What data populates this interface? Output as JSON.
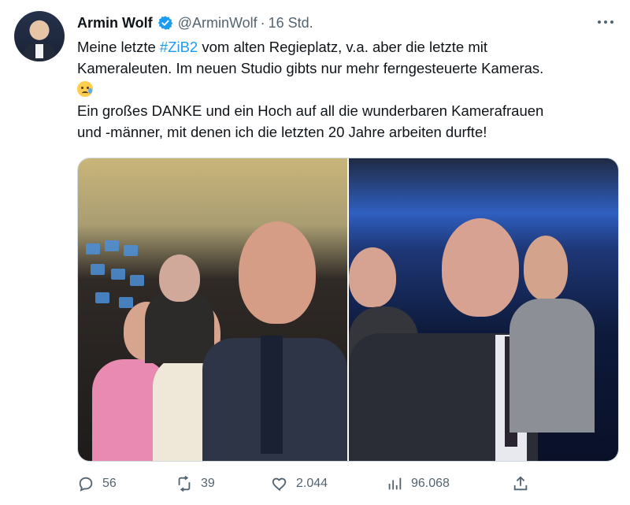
{
  "tweet": {
    "author": {
      "name": "Armin Wolf",
      "handle": "@ArminWolf",
      "time": "16 Std.",
      "separator": "·"
    },
    "text": {
      "line1_before": "Meine letzte ",
      "hashtag": "#ZiB2",
      "line1_after": " vom alten Regieplatz, v.a. aber die letzte mit",
      "line2": "Kameraleuten. Im neuen Studio gibts nur mehr ferngesteuerte Kameras.",
      "line3": "Ein großes DANKE und ein Hoch auf all die wunderbaren Kamerafrauen",
      "line4": "und -männer, mit denen ich die letzten 20 Jahre arbeiten durfte!"
    },
    "emoji": "crying-face",
    "actions": {
      "replies": "56",
      "retweets": "39",
      "likes": "2.044",
      "views": "96.068"
    }
  },
  "colors": {
    "accent": "#1d9bf0",
    "text": "#0f1419",
    "secondary": "#536471"
  },
  "icons": [
    "verified-badge-icon",
    "more-icon",
    "reply-icon",
    "retweet-icon",
    "like-icon",
    "views-icon",
    "share-icon"
  ]
}
